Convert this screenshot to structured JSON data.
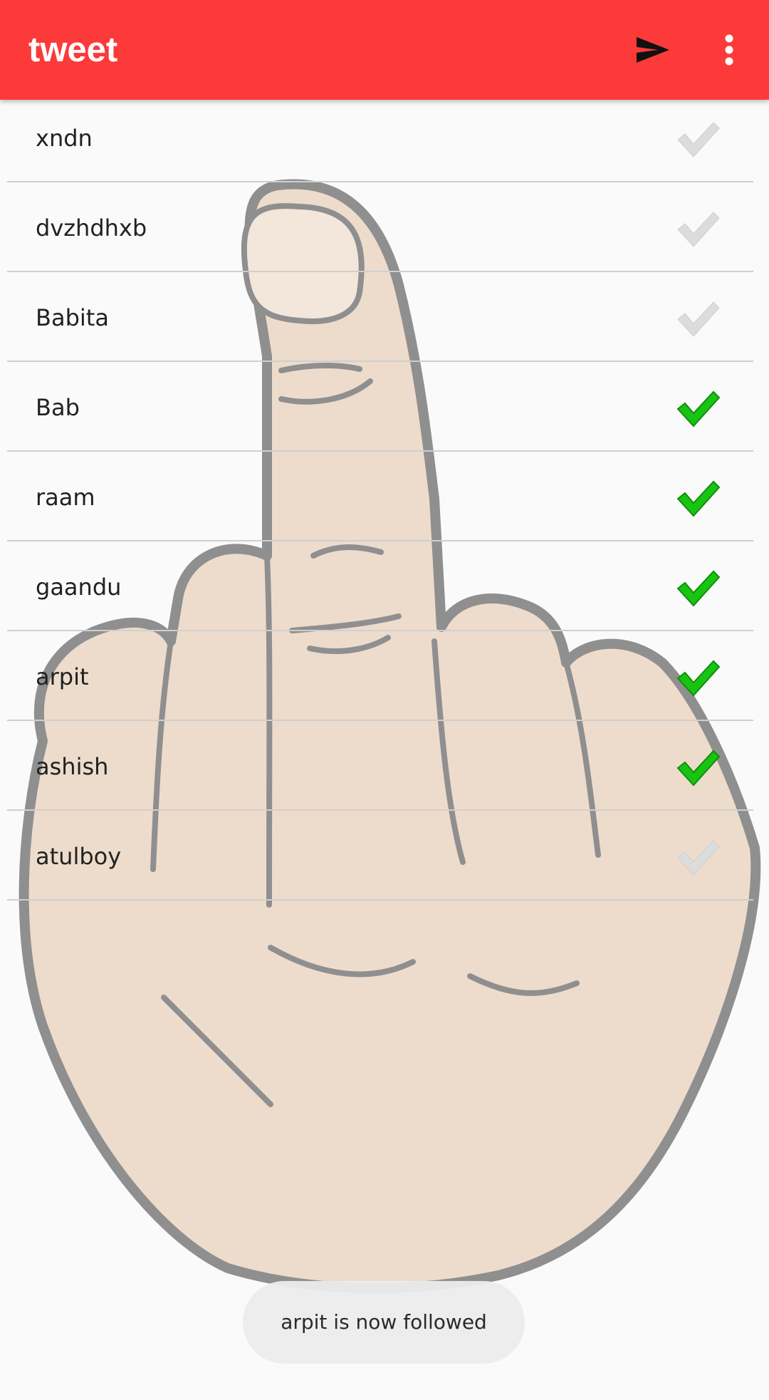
{
  "app_bar": {
    "title": "tweet",
    "send_icon": "send-icon",
    "overflow_icon": "more-vert-icon",
    "background_color": "#fc3a3a"
  },
  "users": [
    {
      "name": "xndn",
      "checked": false
    },
    {
      "name": "dvzhdhxb",
      "checked": false
    },
    {
      "name": "Babita",
      "checked": false
    },
    {
      "name": "Bab",
      "checked": true
    },
    {
      "name": "raam",
      "checked": true
    },
    {
      "name": "gaandu",
      "checked": true
    },
    {
      "name": "arpit",
      "checked": true
    },
    {
      "name": "ashish",
      "checked": true
    },
    {
      "name": "atulboy",
      "checked": false
    }
  ],
  "check_colors": {
    "checked": "#19c312",
    "unchecked": "#dcdcdc"
  },
  "background_image": "hand-gesture-illustration",
  "toast": {
    "message": "arpit is now followed"
  }
}
